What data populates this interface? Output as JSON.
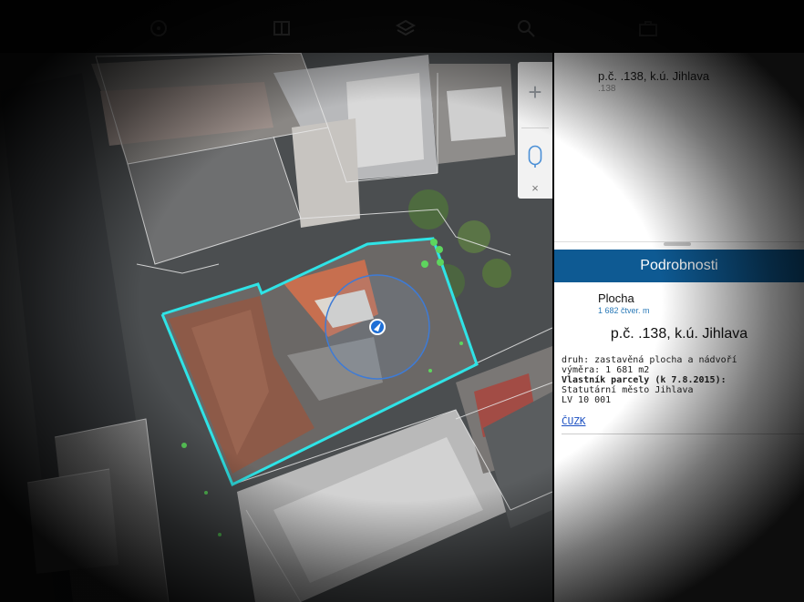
{
  "toolbar": {
    "icons": [
      "location-icon",
      "book-icon",
      "layers-icon",
      "search-icon",
      "briefcase-icon"
    ]
  },
  "map": {
    "controls": {
      "zoom_in": "+",
      "close": "×"
    }
  },
  "pane": {
    "top": {
      "title": "p.č. .138, k.ú. Jihlava",
      "subtitle": ".138"
    },
    "details": {
      "header": "Podrobnosti",
      "area_label": "Plocha",
      "area_value": "1 682 čtver. m",
      "parcel_title": "p.č. .138, k.ú. Jihlava",
      "lines": [
        "druh: zastavěná plocha a nádvoří",
        "výměra: 1 681 m2",
        "Vlastník parcely (k 7.8.2015):",
        "Statutární město Jihlava",
        "LV 10 001"
      ],
      "link": "ČUZK"
    }
  },
  "colors": {
    "parcel_outline": "#2fe3e6",
    "header_blue": "#0e5a93",
    "marker_green": "#5ed55e",
    "link_blue": "#1a4fc2"
  }
}
